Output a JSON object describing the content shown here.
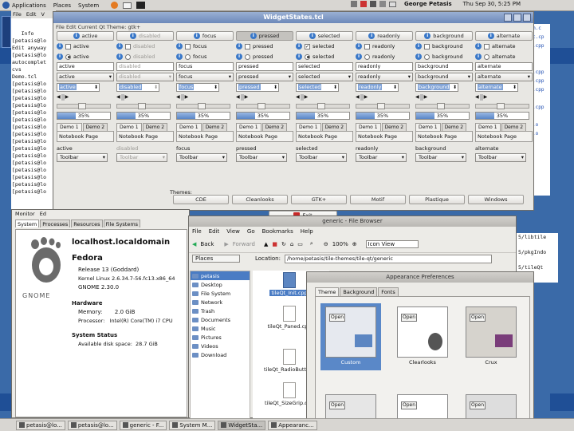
{
  "top_panel": {
    "menus": [
      "Applications",
      "Places",
      "System"
    ],
    "user": "George Petasis",
    "clock": "Thu Sep 30, 5:25 PM"
  },
  "terminal": {
    "menu": [
      "File",
      "Edit",
      "V"
    ],
    "lines": [
      "   Info",
      "",
      "[petasis@lo",
      "Edit anyway",
      "[petasis@lo",
      "autocomplet",
      "cvs",
      "Demo.tcl",
      "[petasis@lo",
      "[petasis@lo",
      "[petasis@lo",
      "[petasis@lo",
      "[petasis@lo",
      "[petasis@lo",
      "[petasis@lo",
      "[petasis@lo",
      "[petasis@lo",
      "[petasis@lo",
      "[petasis@lo",
      "[petasis@lo",
      "[petasis@lo",
      "[petasis@lo",
      "[petasis@lo",
      "[petasis@lo"
    ],
    "right_lines": [
      "m.c",
      "c.cp",
      ".cpp",
      "",
      "",
      ".cpp",
      ".cpp",
      ".cpp",
      "",
      ".cpp",
      "",
      ".o",
      ".o",
      "",
      "",
      "",
      "",
      "",
      ""
    ],
    "right_lines2": [
      "5/libtile",
      "5/pkgIndo",
      "5/tileQt"
    ]
  },
  "widget_window": {
    "title": "WidgetStates.tcl",
    "menu": "File  Edit  Current Qt Theme: gtk+",
    "columns": [
      {
        "name": "active",
        "label": "active",
        "entry": "active",
        "combo": "active",
        "spin": "active",
        "progress": "35%",
        "tab1": "Demo 1",
        "tab2": "Demo 2",
        "page": "Notebook Page",
        "state": "active",
        "toolbar": "Toolbar",
        "pressed": false,
        "disabled": false,
        "check": false,
        "radio": true
      },
      {
        "name": "disabled",
        "label": "disabled",
        "entry": "disabled",
        "combo": "disabled",
        "spin": "disabled",
        "progress": "35%",
        "tab1": "Demo 1",
        "tab2": "Demo 2",
        "page": "Notebook Page",
        "state": "disabled",
        "toolbar": "Toolbar",
        "pressed": false,
        "disabled": true,
        "check": false,
        "radio": false
      },
      {
        "name": "focus",
        "label": "focus",
        "entry": "focus",
        "combo": "focus",
        "spin": "focus",
        "progress": "35%",
        "tab1": "Demo 1",
        "tab2": "Demo 2",
        "page": "Notebook Page",
        "state": "focus",
        "toolbar": "Toolbar",
        "pressed": false,
        "disabled": false,
        "check": false,
        "radio": false
      },
      {
        "name": "pressed",
        "label": "pressed",
        "entry": "pressed",
        "combo": "pressed",
        "spin": "pressed",
        "progress": "35%",
        "tab1": "Demo 1",
        "tab2": "Demo 2",
        "page": "Notebook Page",
        "state": "pressed",
        "toolbar": "Toolbar",
        "pressed": true,
        "disabled": false,
        "check": false,
        "radio": false
      },
      {
        "name": "selected",
        "label": "selected",
        "entry": "selected",
        "combo": "selected",
        "spin": "selected",
        "progress": "35%",
        "tab1": "Demo 1",
        "tab2": "Demo 2",
        "page": "Notebook Page",
        "state": "selected",
        "toolbar": "Toolbar",
        "pressed": false,
        "disabled": false,
        "check": true,
        "radio": true
      },
      {
        "name": "readonly",
        "label": "readonly",
        "entry": "readonly",
        "combo": "readonly",
        "spin": "readonly",
        "progress": "35%",
        "tab1": "Demo 1",
        "tab2": "Demo 2",
        "page": "Notebook Page",
        "state": "readonly",
        "toolbar": "Toolbar",
        "pressed": false,
        "disabled": false,
        "check": false,
        "radio": false
      },
      {
        "name": "background",
        "label": "background",
        "entry": "background",
        "combo": "background",
        "spin": "background",
        "progress": "35%",
        "tab1": "Demo 1",
        "tab2": "Demo 2",
        "page": "Notebook Page",
        "state": "background",
        "toolbar": "Toolbar",
        "pressed": false,
        "disabled": false,
        "check": false,
        "radio": false
      },
      {
        "name": "alternate",
        "label": "alternate",
        "entry": "alternate",
        "combo": "alternate",
        "spin": "alternate",
        "progress": "35%",
        "tab1": "Demo 1",
        "tab2": "Demo 2",
        "page": "Notebook Page",
        "state": "alternate",
        "toolbar": "Toolbar",
        "pressed": false,
        "disabled": false,
        "check": false,
        "radio": false
      }
    ],
    "progress_fraction": 0.35,
    "themes_label": "Themes:",
    "themes": [
      "CDE",
      "Cleanlooks",
      "GTK+",
      "Motif",
      "Plastique",
      "Windows"
    ],
    "exit": "Exit"
  },
  "file_browser": {
    "title": "generic - File Browser",
    "menu": [
      "File",
      "Edit",
      "View",
      "Go",
      "Bookmarks",
      "Help"
    ],
    "toolbar": {
      "back": "Back",
      "forward": "Forward",
      "zoom": "100%",
      "view": "Icon View"
    },
    "location_label": "Location:",
    "location": "/home/petasis/tile-themes/tile-qt/generic",
    "places_label": "Places",
    "places": [
      "petasis",
      "Desktop",
      "File System",
      "Network",
      "Trash",
      "Documents",
      "Music",
      "Pictures",
      "Videos",
      "Download"
    ],
    "files": [
      "tileQt_Init.cpp",
      "tileQt_Paned.cpp",
      "tileQt_RadioButton.cpp",
      "tileQt_SizeGrip.cpp"
    ]
  },
  "sys_monitor": {
    "menu": [
      "Monitor",
      "Ed"
    ],
    "tabs": [
      "System",
      "Processes",
      "Resources",
      "File Systems"
    ],
    "hostname": "localhost.localdomain",
    "distro": "Fedora",
    "release": "Release 13 (Goddard)",
    "kernel": "Kernel Linux 2.6.34.7-56.fc13.x86_64",
    "gnome": "GNOME 2.30.0",
    "logo": "GNOME",
    "hw_title": "Hardware",
    "memory": "Memory:       2.0 GiB",
    "processor": "Processor:   Intel(R) Core(TM) i7 CPU",
    "status_title": "System Status",
    "disk": "Available disk space:  28.7 GiB"
  },
  "appearance": {
    "title": "Appearance Preferences",
    "tabs": [
      "Theme",
      "Background",
      "Fonts"
    ],
    "themes": [
      "Custom",
      "Clearlooks",
      "Crux"
    ],
    "preview_button": "Open"
  },
  "taskbar": [
    "petasis@lo...",
    "petasis@lo...",
    "generic - F...",
    "System M...",
    "WidgetSta...",
    "Appearanc..."
  ],
  "colors": {
    "accent": "#4a7cc4",
    "title": "#6d89b9",
    "desktop": "#3a6aa8"
  }
}
